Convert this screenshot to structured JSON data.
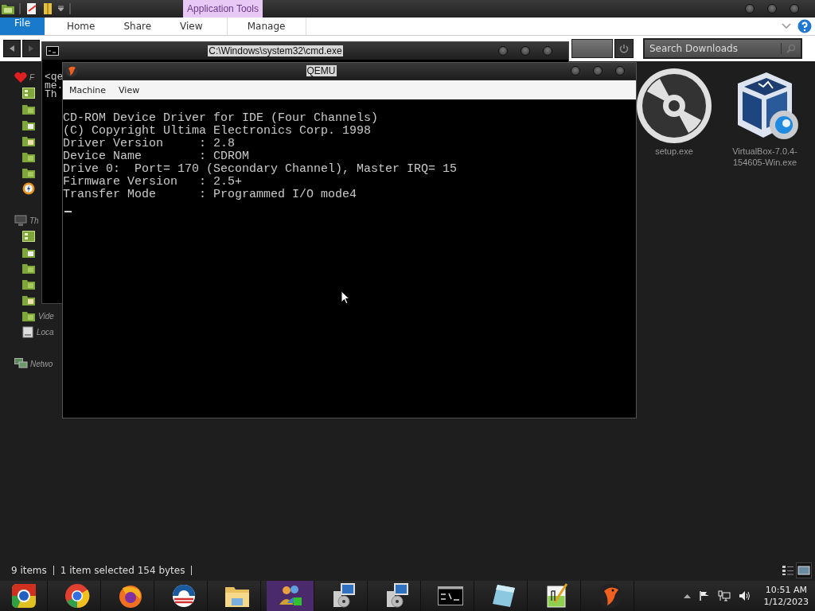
{
  "explorer": {
    "contextual_tab": "Application Tools",
    "ribbon_tabs": [
      {
        "label": "File",
        "kind": "file"
      },
      {
        "label": "Home",
        "kind": "tab"
      },
      {
        "label": "Share",
        "kind": "tab"
      },
      {
        "label": "View",
        "kind": "tab"
      },
      {
        "label": "Manage",
        "kind": "contextual"
      }
    ],
    "search": {
      "placeholder": "Search Downloads"
    },
    "nav_items": [
      {
        "kind": "heart",
        "label": "F"
      },
      {
        "kind": "desktop"
      },
      {
        "kind": "music"
      },
      {
        "kind": "docs"
      },
      {
        "kind": "pictures"
      },
      {
        "kind": "videos"
      },
      {
        "kind": "music"
      },
      {
        "kind": "orange"
      },
      {
        "kind": "gap"
      },
      {
        "kind": "monitor",
        "label": "Th"
      },
      {
        "kind": "desktop"
      },
      {
        "kind": "docs"
      },
      {
        "kind": "music"
      },
      {
        "kind": "music"
      },
      {
        "kind": "pictures"
      },
      {
        "kind": "videos",
        "label": "Vide"
      },
      {
        "kind": "drive",
        "label": "Loca"
      },
      {
        "kind": "gap"
      },
      {
        "kind": "network",
        "label": "Netwo"
      }
    ],
    "files": [
      {
        "kind": "disc",
        "name": "setup.exe"
      },
      {
        "kind": "cube",
        "name": "VirtualBox-7.0.4-154605-Win.exe"
      }
    ],
    "status": [
      "9 items",
      "1 item selected  154 bytes"
    ]
  },
  "cmd_window": {
    "title": "C:\\Windows\\system32\\cmd.exe",
    "lines": [
      "<qe",
      "me.",
      "Th"
    ]
  },
  "qemu_window": {
    "title": "QEMU",
    "menu": [
      "Machine",
      "View"
    ],
    "console": [
      "CD-ROM Device Driver for IDE (Four Channels)",
      "(C) Copyright Ultima Electronics Corp. 1998",
      "Driver Version     : 2.8",
      "Device Name        : CDROM",
      "Drive 0:  Port= 170 (Secondary Channel), Master IRQ= 15",
      "Firmware Version   : 2.5+",
      "Transfer Mode      : Programmed I/O mode4"
    ]
  },
  "taskbar": {
    "apps": [
      {
        "kind": "chrome-old",
        "highlighted": false
      },
      {
        "kind": "chrome",
        "highlighted": false
      },
      {
        "kind": "firefox",
        "highlighted": false
      },
      {
        "kind": "striped",
        "highlighted": false
      },
      {
        "kind": "folder",
        "highlighted": false
      },
      {
        "kind": "people",
        "highlighted": true
      },
      {
        "kind": "installer",
        "highlighted": false
      },
      {
        "kind": "installer",
        "highlighted": false
      },
      {
        "kind": "cmd",
        "highlighted": false
      },
      {
        "kind": "notepad",
        "highlighted": false
      },
      {
        "kind": "notepadpp",
        "highlighted": false
      },
      {
        "kind": "bird",
        "highlighted": false
      }
    ],
    "time": "10:51 AM",
    "date": "1/12/2023"
  }
}
